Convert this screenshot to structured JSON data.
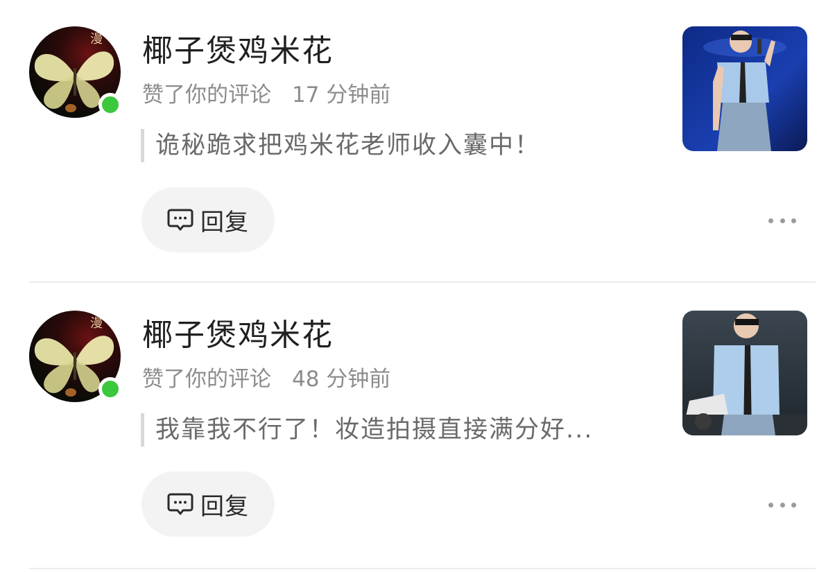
{
  "notifications": [
    {
      "username": "椰子煲鸡米花",
      "action": "赞了你的评论",
      "time": "17 分钟前",
      "comment": "诡秘跪求把鸡米花老师收入囊中！",
      "reply_label": "回复",
      "online": true
    },
    {
      "username": "椰子煲鸡米花",
      "action": "赞了你的评论",
      "time": "48 分钟前",
      "comment": "我靠我不行了！妆造拍摄直接满分好...",
      "reply_label": "回复",
      "online": true
    }
  ],
  "colors": {
    "online": "#3cc83c",
    "text_primary": "#1f1f1f",
    "text_secondary": "#8c8c8c",
    "button_bg": "#f3f3f3"
  },
  "icons": {
    "reply": "chat-bubble-icon",
    "more": "ellipsis-icon"
  }
}
